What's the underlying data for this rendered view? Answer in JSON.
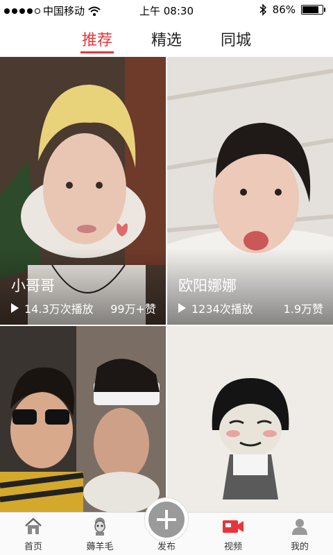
{
  "status_bar": {
    "carrier": "中国移动",
    "time": "上午 08:30",
    "battery": "86%",
    "battery_level": 0.86,
    "signal_dots_filled": 4,
    "signal_dots_total": 5
  },
  "tabs": [
    {
      "label": "推荐",
      "active": true
    },
    {
      "label": "精选",
      "active": false
    },
    {
      "label": "同城",
      "active": false
    }
  ],
  "cards": [
    {
      "title": "小哥哥",
      "plays": "14.3万次播放",
      "likes": "99万+赞"
    },
    {
      "title": "欧阳娜娜",
      "plays": "1234次播放",
      "likes": "1.9万赞"
    },
    {
      "title": "",
      "plays": "",
      "likes": ""
    },
    {
      "title": "",
      "plays": "",
      "likes": ""
    }
  ],
  "nav": [
    {
      "label": "首页",
      "icon": "home-icon"
    },
    {
      "label": "薅羊毛",
      "icon": "sheep-icon"
    },
    {
      "label": "发布",
      "icon": "plus-icon"
    },
    {
      "label": "视频",
      "icon": "video-icon"
    },
    {
      "label": "我的",
      "icon": "user-icon"
    }
  ],
  "colors": {
    "accent": "#e8353a"
  }
}
